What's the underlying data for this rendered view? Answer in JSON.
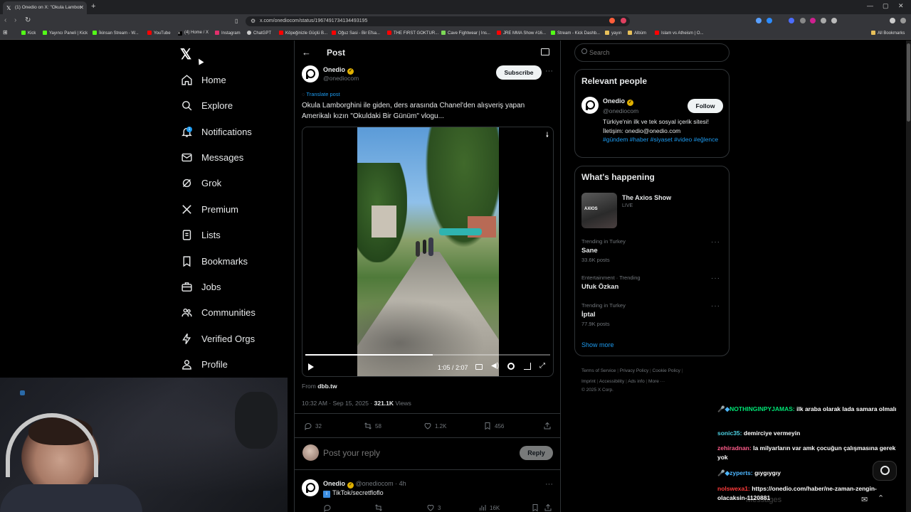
{
  "browser": {
    "tab_title": "(1) Onedio on X: \"Okula Lambor",
    "url": "x.com/onediocom/status/1967491734134493195",
    "bookmarks": [
      "Kick",
      "Yayıncı Paneli | Kick",
      "İkinsan Stream - W...",
      "YouTube",
      "(4) Home / X",
      "Instagram",
      "ChatGPT",
      "Köpeğinizle Güçlü B...",
      "Oğuz Sasi - Bir Efsa...",
      "THE FIRST GOKTUR...",
      "Cave Fightwear | Ins...",
      "JRE MMA Show #16...",
      "Stream - Kick Dashb...",
      "yayın",
      "Albüm",
      "Islam vs Atheism | O..."
    ],
    "all_bookmarks": "All Bookmarks"
  },
  "nav": {
    "items": [
      {
        "label": "Home",
        "icon": "home-icon"
      },
      {
        "label": "Explore",
        "icon": "search-icon"
      },
      {
        "label": "Notifications",
        "icon": "bell-icon",
        "badge": "1"
      },
      {
        "label": "Messages",
        "icon": "envelope-icon"
      },
      {
        "label": "Grok",
        "icon": "grok-icon"
      },
      {
        "label": "Premium",
        "icon": "x-logo-icon"
      },
      {
        "label": "Lists",
        "icon": "list-icon"
      },
      {
        "label": "Bookmarks",
        "icon": "bookmark-icon"
      },
      {
        "label": "Jobs",
        "icon": "briefcase-icon"
      },
      {
        "label": "Communities",
        "icon": "people-icon"
      },
      {
        "label": "Verified Orgs",
        "icon": "lightning-icon"
      },
      {
        "label": "Profile",
        "icon": "person-icon"
      }
    ]
  },
  "post": {
    "header_title": "Post",
    "author_name": "Onedio",
    "author_handle": "@onediocom",
    "subscribe_label": "Subscribe",
    "translate_label": "Translate post",
    "text": "Okula Lamborghini ile giden, ders arasında Chanel'den alışveriş yapan Amerikalı kızın \"Okuldaki Bir Günüm\" vlogu...",
    "video_time": "1:05 / 2:07",
    "video_progress": 0.52,
    "from_label": "From",
    "from_source": "dbb.tw",
    "timestamp": "10:32 AM · Sep 15, 2025 ·",
    "views_count": "321.1K",
    "views_label": "Views",
    "stats": {
      "replies": "32",
      "reposts": "58",
      "likes": "1.2K",
      "bookmarks": "456"
    },
    "reply_placeholder": "Post your reply",
    "reply_button": "Reply"
  },
  "reply_post": {
    "author_name": "Onedio",
    "author_handle": "@onediocom · 4h",
    "text": "TikTok/secretfloflo",
    "stats": {
      "replies": "",
      "reposts": "",
      "likes": "3",
      "views": "16K"
    }
  },
  "right": {
    "search_placeholder": "Search",
    "relevant_title": "Relevant people",
    "person_name": "Onedio",
    "person_handle": "@onediocom",
    "follow_label": "Follow",
    "person_bio": "Türkiye'nin ilk ve tek sosyal içerik sitesi! İletişim: onedio@onedio.com",
    "person_tags": "#gündem #haber #siyaset #video #eğlence",
    "happening_title": "What's happening",
    "live_show_title": "The Axios Show",
    "live_label": "LIVE",
    "trends": [
      {
        "meta": "Trending in Turkey",
        "name": "Sane",
        "count": "33.6K posts"
      },
      {
        "meta": "Entertainment · Trending",
        "name": "Ufuk Özkan",
        "count": ""
      },
      {
        "meta": "Trending in Turkey",
        "name": "İptal",
        "count": "77.9K posts"
      }
    ],
    "show_more": "Show more",
    "footer_line1": [
      "Terms of Service",
      "Privacy Policy",
      "Cookie Policy"
    ],
    "footer_line2": [
      "Imprint",
      "Accessibility",
      "Ads info",
      "More ···"
    ],
    "copyright": "© 2025 X Corp."
  },
  "chat": [
    {
      "user": "NOTHINGINPYJAMAS:",
      "msg": "ilk araba olarak lada samara olmalı",
      "color": "#00e676"
    },
    {
      "user": "sonic35:",
      "msg": "demirciye vermeyin",
      "color": "#4dd0e1"
    },
    {
      "user": "zehiradnan:",
      "msg": "la milyarların var amk çocuğun çalışmasına gerek yok",
      "color": "#ff5c8a"
    },
    {
      "user": "zyperts:",
      "msg": "gıygıygıy",
      "color": "#4db6ff"
    },
    {
      "user": "nolswexa1:",
      "msg": "https://onedio.com/haber/ne-zaman-zengin-olacaksin-1120881",
      "color": "#ff3b3b"
    }
  ],
  "chat_overlay_label": "Messages"
}
